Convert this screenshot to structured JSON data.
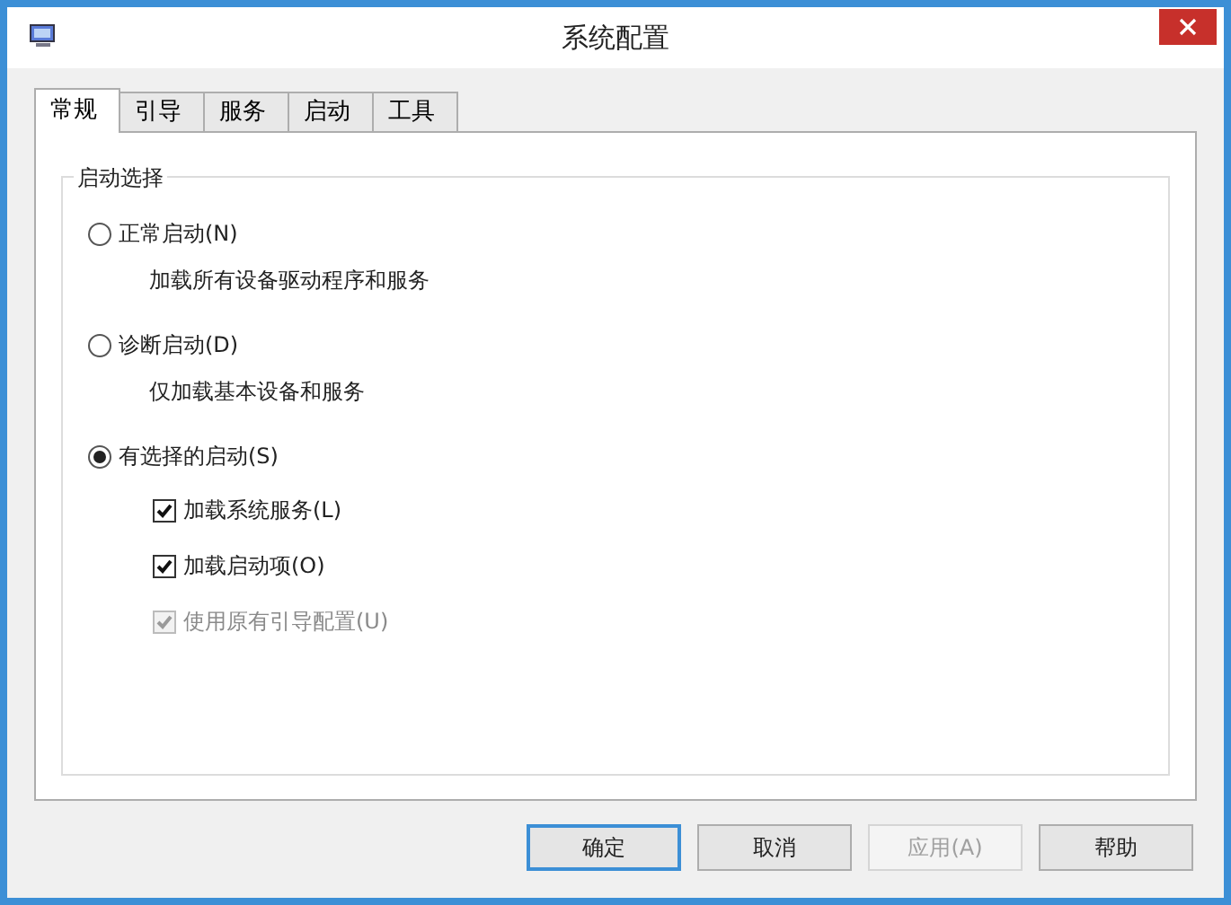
{
  "window": {
    "title": "系统配置"
  },
  "tabs": [
    {
      "label": "常规",
      "selected": true
    },
    {
      "label": "引导",
      "selected": false
    },
    {
      "label": "服务",
      "selected": false
    },
    {
      "label": "启动",
      "selected": false
    },
    {
      "label": "工具",
      "selected": false
    }
  ],
  "group": {
    "title": "启动选择",
    "options": [
      {
        "label": "正常启动(N)",
        "description": "加载所有设备驱动程序和服务",
        "selected": false
      },
      {
        "label": "诊断启动(D)",
        "description": "仅加载基本设备和服务",
        "selected": false
      },
      {
        "label": "有选择的启动(S)",
        "selected": true,
        "checkboxes": [
          {
            "label": "加载系统服务(L)",
            "checked": true,
            "disabled": false
          },
          {
            "label": "加载启动项(O)",
            "checked": true,
            "disabled": false
          },
          {
            "label": "使用原有引导配置(U)",
            "checked": true,
            "disabled": true
          }
        ]
      }
    ]
  },
  "buttons": [
    {
      "label": "确定",
      "default": true,
      "disabled": false
    },
    {
      "label": "取消",
      "default": false,
      "disabled": false
    },
    {
      "label": "应用(A)",
      "default": false,
      "disabled": true
    },
    {
      "label": "帮助",
      "default": false,
      "disabled": false
    }
  ]
}
